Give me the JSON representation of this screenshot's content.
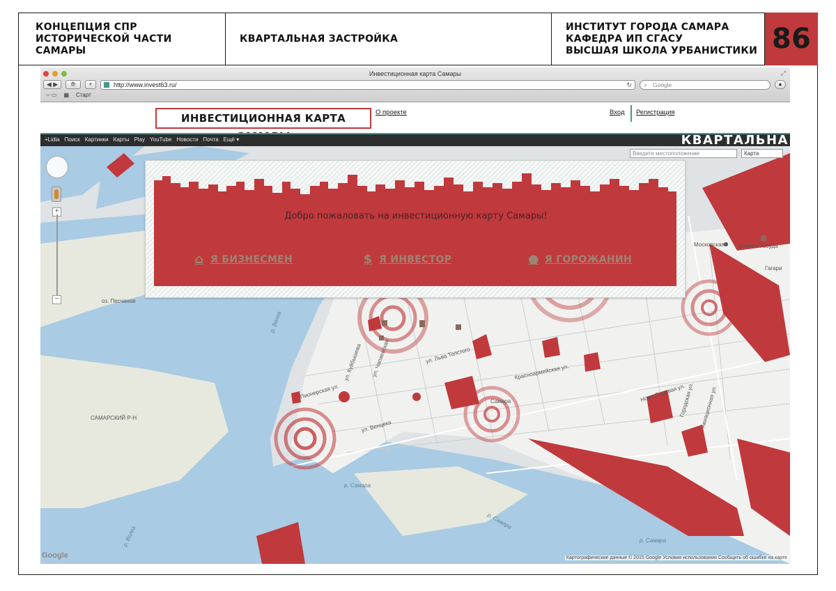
{
  "slide_header": {
    "left_title": "КОНЦЕПЦИЯ СПР\nИСТОРИЧЕСКОЙ ЧАСТИ САМАРЫ",
    "section_title": "КВАРТАЛЬНАЯ ЗАСТРОЙКА",
    "institution": "ИНСТИТУТ ГОРОДА САМАРА\nКАФЕДРА ИП СГАСУ\nВЫСШАЯ ШКОЛА УРБАНИСТИКИ",
    "page_number": "86",
    "accent_color": "#c0393c"
  },
  "browser": {
    "window_title": "Инвестиционная карта Самары",
    "url": "http://www.invest63.ru/",
    "search_placeholder": "Google",
    "bookmarks": [
      "Старт"
    ]
  },
  "site": {
    "title": "ИНВЕСТИЦИОННАЯ КАРТА САМАРЫ",
    "about_link": "О проекте",
    "login_link": "Вход",
    "register_link": "Регистрация",
    "accent_color": "#3d9b8f"
  },
  "google_bar": {
    "items": [
      "+Lidia",
      "Поиск",
      "Картинки",
      "Карты",
      "Play",
      "YouTube",
      "Новости",
      "Почта",
      "Ещё ▾"
    ],
    "brand_overlay": "КВАРТАЛЬНА"
  },
  "map": {
    "search_placeholder": "Введите местоположение",
    "map_type": "Карта",
    "labels": {
      "peschanoe": "оз. Песчаное",
      "samarsky": "САМАРСКИЙ Р-Н",
      "samara_city": "Самара",
      "moskovskaya": "Московская",
      "volga1": "р. Волга",
      "volga2": "р. Волга",
      "samara_river1": "р. Самара",
      "samara_river2": "р. Самара",
      "samara_river3": "р. Самара",
      "lev_tolstogo": "ул. Льва Толстого",
      "ventseka": "ул. Венцека",
      "chapaevskaya": "ул. Чапаевская",
      "kuibysheva": "ул. Куйбышева",
      "pionerskaya": "Пионерская ул.",
      "krasnoarmeyskaya": "Красноармейская ул.",
      "novo_sadovaya": "Ново-Садовая ул.",
      "gorodskaya": "Городская ул.",
      "aviatsionnaya": "Авиационная ул.",
      "gegarin": "Гагари",
      "klinich": "Клинич. Госуда"
    },
    "attribution": "Картографические данные © 2015 Google   Условия использования   Сообщить об ошибке на карте",
    "google_logo": "Google",
    "zoom_in": "+",
    "zoom_out": "−",
    "highlight_color": "#c0393c"
  },
  "modal": {
    "welcome": "Добро пожаловать на инвестиционную карту Самары!",
    "businessman": "Я БИЗНЕСМЕН",
    "investor": "Я ИНВЕСТОР",
    "citizen": "Я ГОРОЖАНИН"
  }
}
